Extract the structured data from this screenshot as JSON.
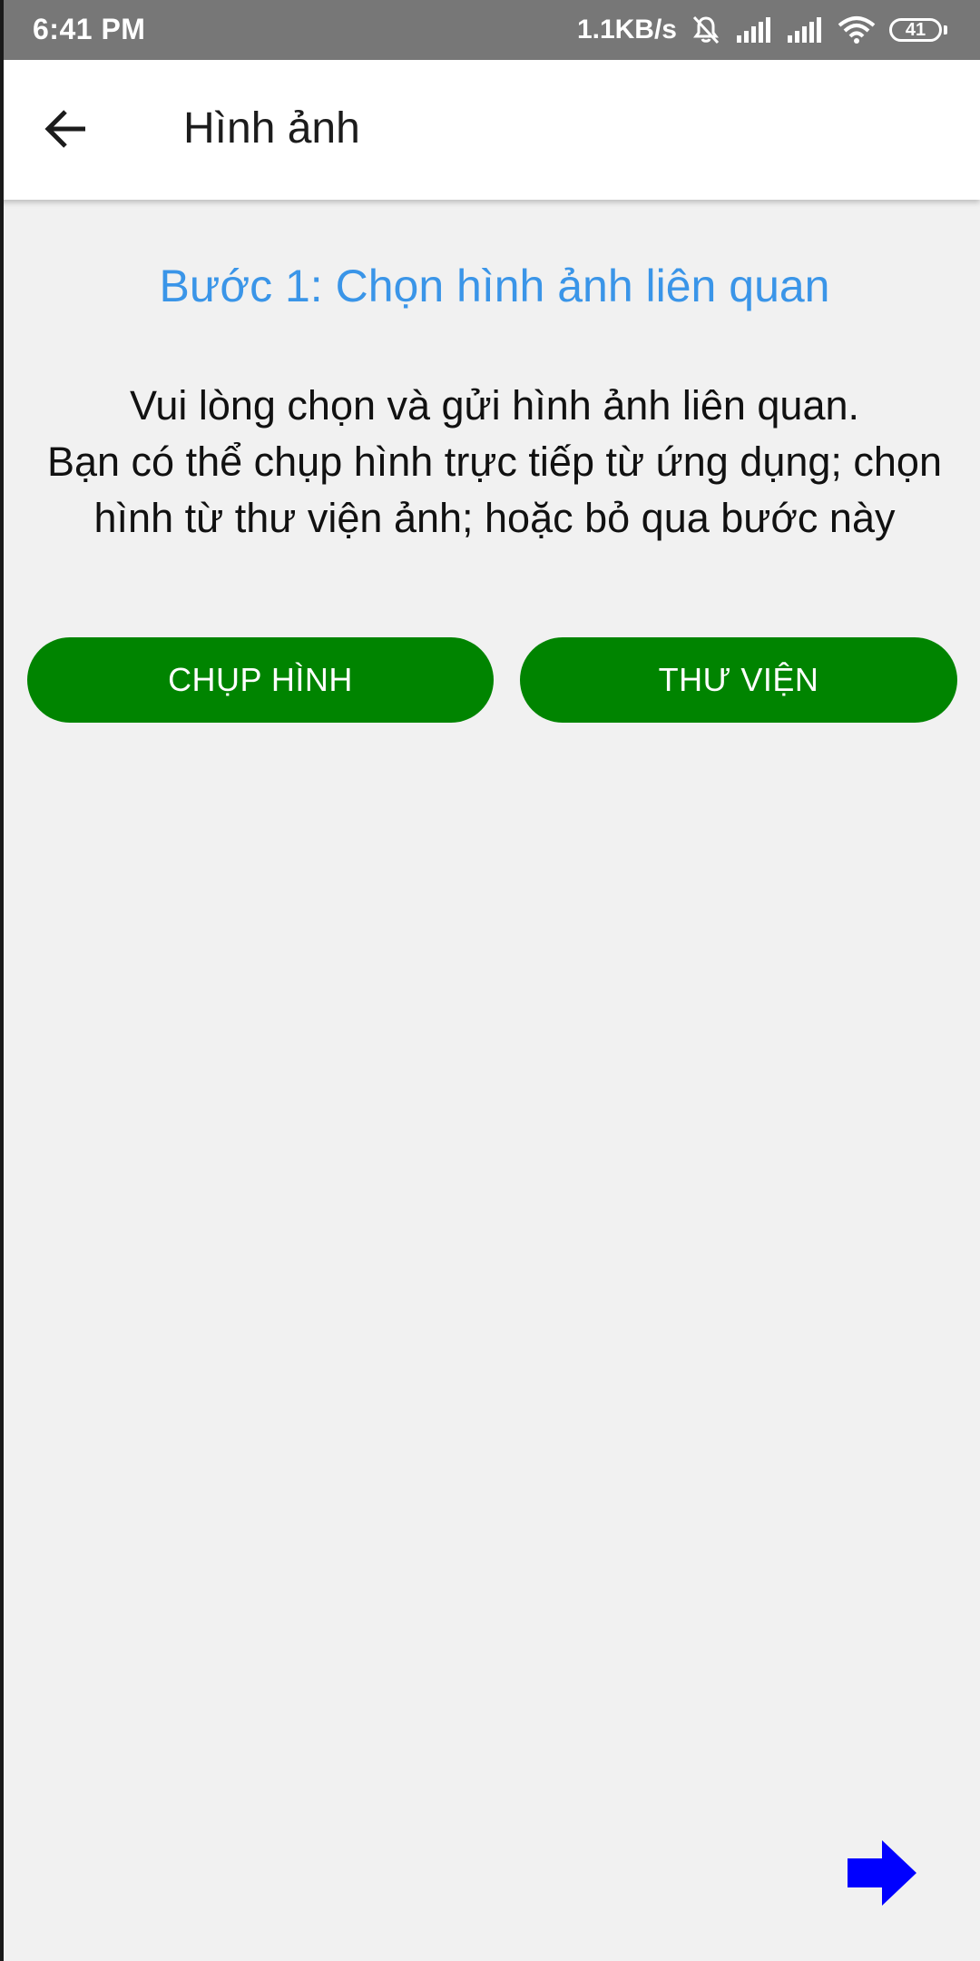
{
  "status_bar": {
    "time": "6:41 PM",
    "network_speed": "1.1KB/s",
    "battery_level": "41",
    "icons": [
      "muted-bell-icon",
      "signal-icon",
      "signal-icon",
      "wifi-icon",
      "battery-icon"
    ]
  },
  "app_bar": {
    "title": "Hình ảnh",
    "back_icon": "arrow-left-icon"
  },
  "main": {
    "step_title": "Bước 1: Chọn hình ảnh liên quan",
    "instructions": [
      "Vui lòng chọn và gửi hình ảnh liên quan.",
      "Bạn có thể chụp hình trực tiếp từ ứng dụng; chọn",
      "hình từ thư viện ảnh; hoặc bỏ qua bước này"
    ],
    "buttons": {
      "camera_label": "CHỤP HÌNH",
      "library_label": "THƯ VIỆN"
    },
    "next_icon": "arrow-right-icon"
  },
  "colors": {
    "status_bar": "#777777",
    "step_title": "#3a95e8",
    "button": "#008400",
    "next_arrow": "#0000ff",
    "background": "#f1f1f1"
  }
}
